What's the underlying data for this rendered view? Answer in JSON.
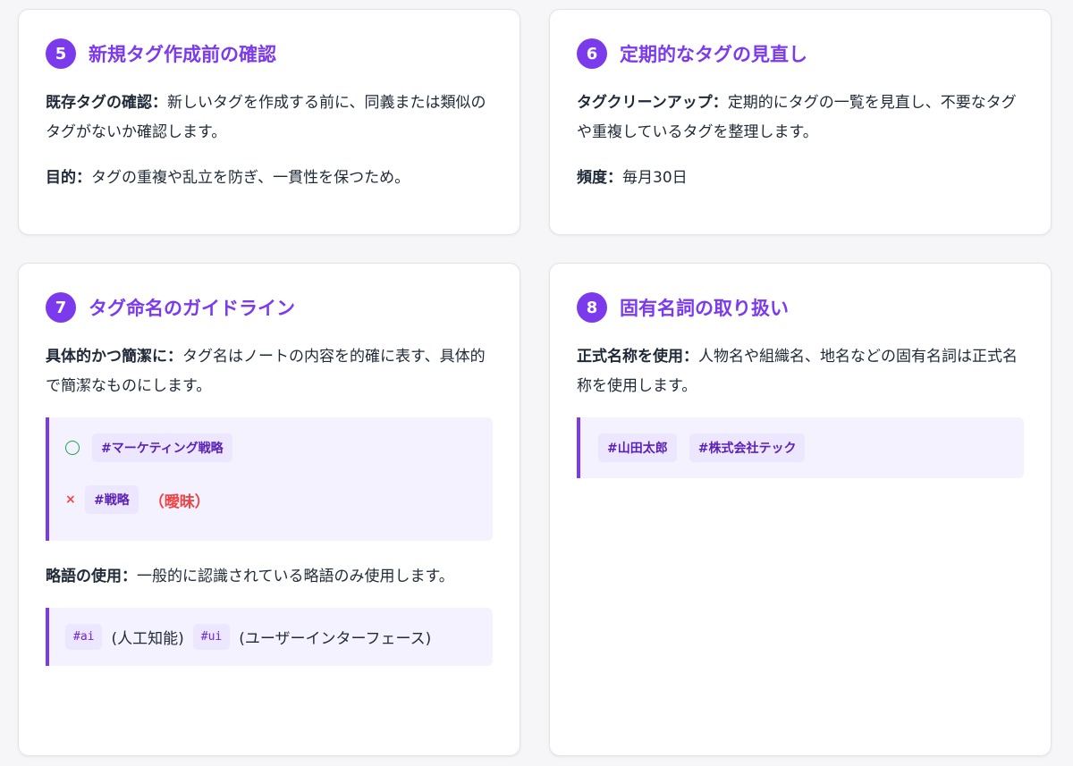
{
  "sections": [
    {
      "number": "5",
      "title": "新規タグ作成前の確認",
      "paras": [
        {
          "label": "既存タグの確認：",
          "text": "新しいタグを作成する前に、同義または類似のタグがないか確認します。"
        },
        {
          "label": "目的：",
          "text": "タグの重複や乱立を防ぎ、一貫性を保つため。"
        }
      ]
    },
    {
      "number": "6",
      "title": "定期的なタグの見直し",
      "paras": [
        {
          "label": "タグクリーンアップ：",
          "text": "定期的にタグの一覧を見直し、不要なタグや重複しているタグを整理します。"
        },
        {
          "label": "頻度：",
          "text": "毎月30日"
        }
      ]
    },
    {
      "number": "7",
      "title": "タグ命名のガイドライン",
      "paras": [
        {
          "label": "具体的かつ簡潔に：",
          "text": "タグ名はノートの内容を的確に表す、具体的で簡潔なものにします。"
        },
        {
          "label": "略語の使用：",
          "text": "一般的に認識されている略語のみ使用します。"
        }
      ],
      "good_tag": "#マーケティング戦略",
      "bad_mark": "×",
      "bad_tag": "#戦略",
      "bad_note": "（曖昧）",
      "abbr_examples": [
        {
          "code": "#ai",
          "meaning": "(人工知能)"
        },
        {
          "code": "#ui",
          "meaning": "(ユーザーインターフェース)"
        }
      ]
    },
    {
      "number": "8",
      "title": "固有名詞の取り扱い",
      "paras": [
        {
          "label": "正式名称を使用：",
          "text": "人物名や組織名、地名などの固有名詞は正式名称を使用します。"
        }
      ],
      "tags": [
        "#山田太郎",
        "#株式会社テック"
      ]
    }
  ],
  "colors": {
    "accent": "#7c3aed",
    "good": "#16a34a",
    "bad": "#ef4444",
    "example_bg": "#f5f2ff"
  },
  "icons": {
    "good": "circle-check-icon",
    "bad": "x-mark-icon"
  }
}
